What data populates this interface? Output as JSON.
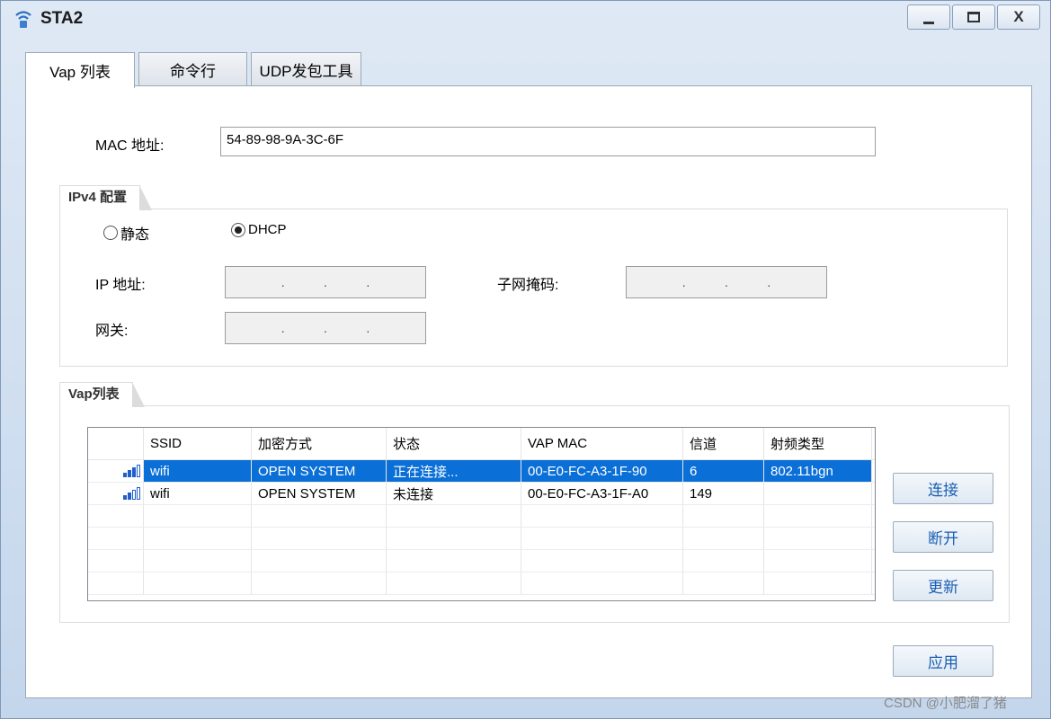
{
  "window": {
    "title": "STA2",
    "minimize_icon": "minimize-icon",
    "maximize_icon": "maximize-icon",
    "close_label": "X"
  },
  "tabs": [
    {
      "label": "Vap 列表",
      "active": true
    },
    {
      "label": "命令行",
      "active": false
    },
    {
      "label": "UDP发包工具",
      "active": false
    }
  ],
  "mac": {
    "label": "MAC 地址:",
    "value": "54-89-98-9A-3C-6F"
  },
  "ipv4": {
    "group_label": "IPv4 配置",
    "static_label": "静态",
    "dhcp_label": "DHCP",
    "selected": "DHCP",
    "ip_label": "IP 地址:",
    "mask_label": "子网掩码:",
    "gateway_label": "网关:",
    "dot": "."
  },
  "vap": {
    "group_label": "Vap列表",
    "columns": [
      "",
      "SSID",
      "加密方式",
      "状态",
      "VAP MAC",
      "信道",
      "射频类型"
    ],
    "rows": [
      {
        "signal_bars": 3,
        "ssid": "wifi",
        "encryption": "OPEN SYSTEM",
        "status": "正在连接...",
        "mac": "00-E0-FC-A3-1F-90",
        "channel": "6",
        "radio": "802.11bgn",
        "selected": true
      },
      {
        "signal_bars": 2,
        "ssid": "wifi",
        "encryption": "OPEN SYSTEM",
        "status": "未连接",
        "mac": "00-E0-FC-A3-1F-A0",
        "channel": "149",
        "radio": "",
        "selected": false
      }
    ],
    "empty_rows": 4
  },
  "buttons": {
    "connect": "连接",
    "disconnect": "断开",
    "refresh": "更新",
    "apply": "应用"
  },
  "watermark": "CSDN @小肥溜了猪",
  "colors": {
    "selection": "#0a6fd6",
    "accent_text": "#1a5fb4",
    "signal": "#1f5fc9"
  }
}
